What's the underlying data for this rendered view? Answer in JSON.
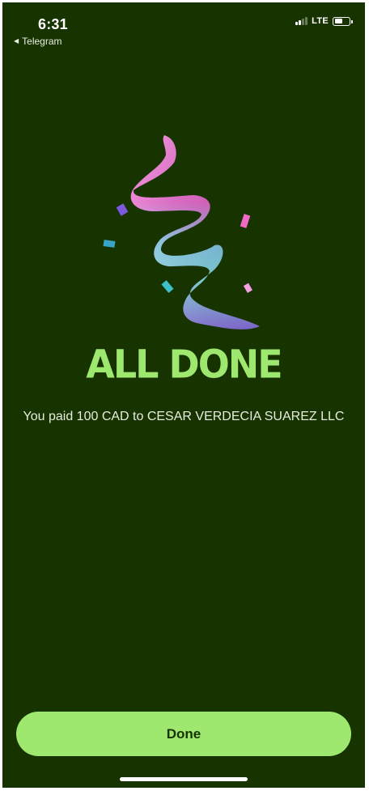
{
  "status_bar": {
    "time": "6:31",
    "back_app_label": "Telegram",
    "network": "LTE",
    "battery_level": 0.55
  },
  "confirmation": {
    "headline": "ALL DONE",
    "message": "You paid 100 CAD to CESAR VERDECIA SUAREZ LLC"
  },
  "actions": {
    "done_label": "Done"
  },
  "colors": {
    "background": "#173300",
    "accent": "#9fe870",
    "button_text": "#163300"
  },
  "icons": {
    "back": "back-arrow-icon",
    "signal": "cellular-signal-icon",
    "battery": "battery-icon",
    "illustration": "confetti-ribbon-illustration"
  }
}
